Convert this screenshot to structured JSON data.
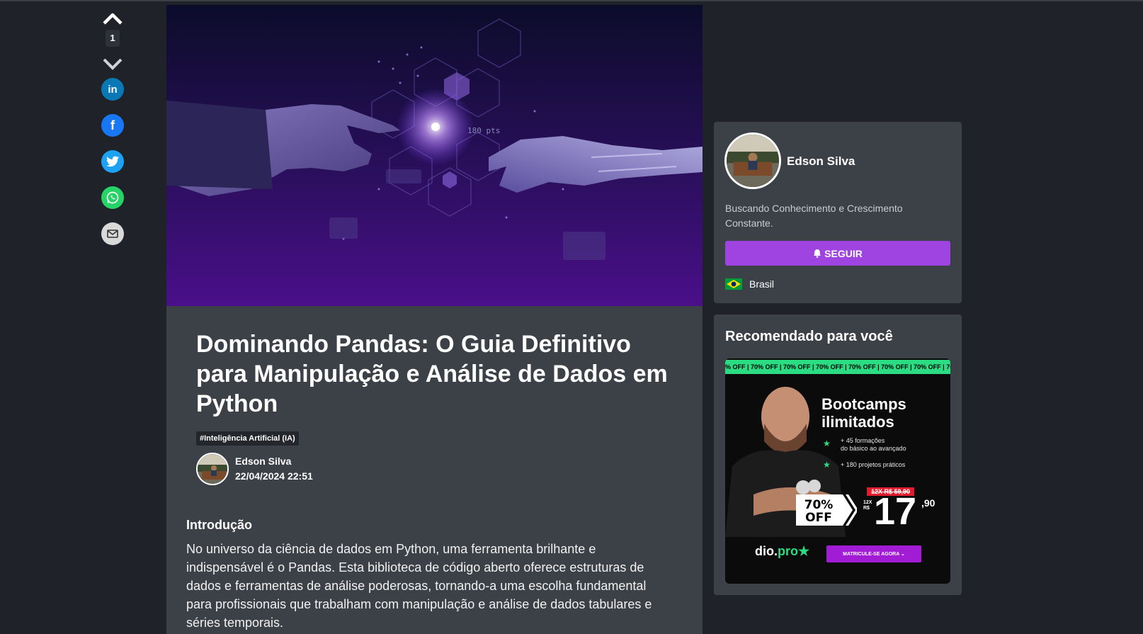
{
  "vote": {
    "count": "1"
  },
  "share": [
    {
      "name": "linkedin",
      "icon": "linkedin-icon",
      "color": "#0a78b5",
      "glyph": "in"
    },
    {
      "name": "facebook",
      "icon": "facebook-icon",
      "color": "#1877f2",
      "glyph": "f"
    },
    {
      "name": "twitter",
      "icon": "twitter-icon",
      "color": "#1da1f2"
    },
    {
      "name": "whatsapp",
      "icon": "whatsapp-icon",
      "color": "#25d366"
    },
    {
      "name": "email",
      "icon": "mail-icon",
      "color": "#d9d9d9"
    }
  ],
  "article": {
    "title": "Dominando Pandas: O Guia Definitivo para Manipulação e Análise de Dados em Python",
    "tag": "#Inteligência Artificial (IA)",
    "author": "Edson Silva",
    "date": "22/04/2024 22:51",
    "section_heading": "Introdução",
    "intro": "No universo da ciência de dados em Python, uma ferramenta brilhante e indispensável é o Pandas. Esta biblioteca de código aberto oferece estruturas de dados e ferramentas de análise poderosas, tornando-a uma escolha fundamental para profissionais que trabalham com manipulação e análise de dados tabulares e séries temporais.",
    "hero_overlay_text": "180 pts"
  },
  "profile": {
    "name": "Edson Silva",
    "bio": "Buscando Conhecimento e Crescimento Constante.",
    "follow_label": "SEGUIR",
    "country": "Brasil"
  },
  "recommended": {
    "title": "Recomendado para você",
    "ticker": "% OFF | 70% OFF | 70% OFF | 70% OFF | 70% OFF | 70% OFF | 70% OFF | 70% O",
    "headline_1": "Bootcamps",
    "headline_2": "ilimitados",
    "bullet_1a": "+ 45 formações",
    "bullet_1b": "do básico ao avançado",
    "bullet_2": "+ 180 projetos práticos",
    "old_price": "12X R$ 59,90",
    "off_1": "70%",
    "off_2": "OFF",
    "price_prefix_1": "12X",
    "price_prefix_2": "R$",
    "price": "17",
    "price_cents": ",90",
    "brand_a": "dio.",
    "brand_b": "pro",
    "cta": "MATRICULE-SE AGORA ⌄"
  },
  "colors": {
    "accent": "#9f44e0",
    "card": "#3c4148",
    "background": "#1f2329",
    "green": "#2bdc83"
  }
}
